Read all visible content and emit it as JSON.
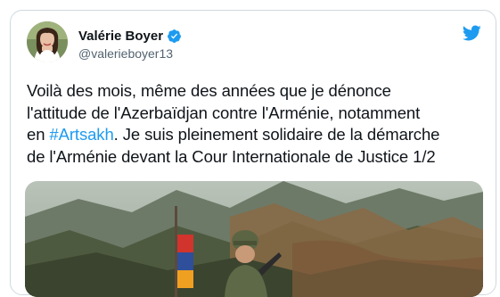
{
  "tweet": {
    "author": {
      "display_name": "Valérie Boyer",
      "handle": "@valerieboyer13",
      "verified": true,
      "avatar_icon": "author-avatar"
    },
    "text_parts": {
      "before": "Voilà des mois, même des années que je dénonce\nl'attitude de l'Azerbaïdjan contre l'Arménie, notamment\nen ",
      "hashtag": "#Artsakh",
      "after": ". Je suis pleinement solidaire de la démarche\nde l'Arménie devant la Cour Internationale de Justice 1/2"
    },
    "colors": {
      "brand": "#1d9bf0",
      "text": "#0f1419",
      "secondary": "#536471"
    },
    "icons": [
      "verified-badge-icon",
      "twitter-bird-icon"
    ],
    "media": {
      "icon": "photo-soldier-with-armenian-flag"
    }
  }
}
